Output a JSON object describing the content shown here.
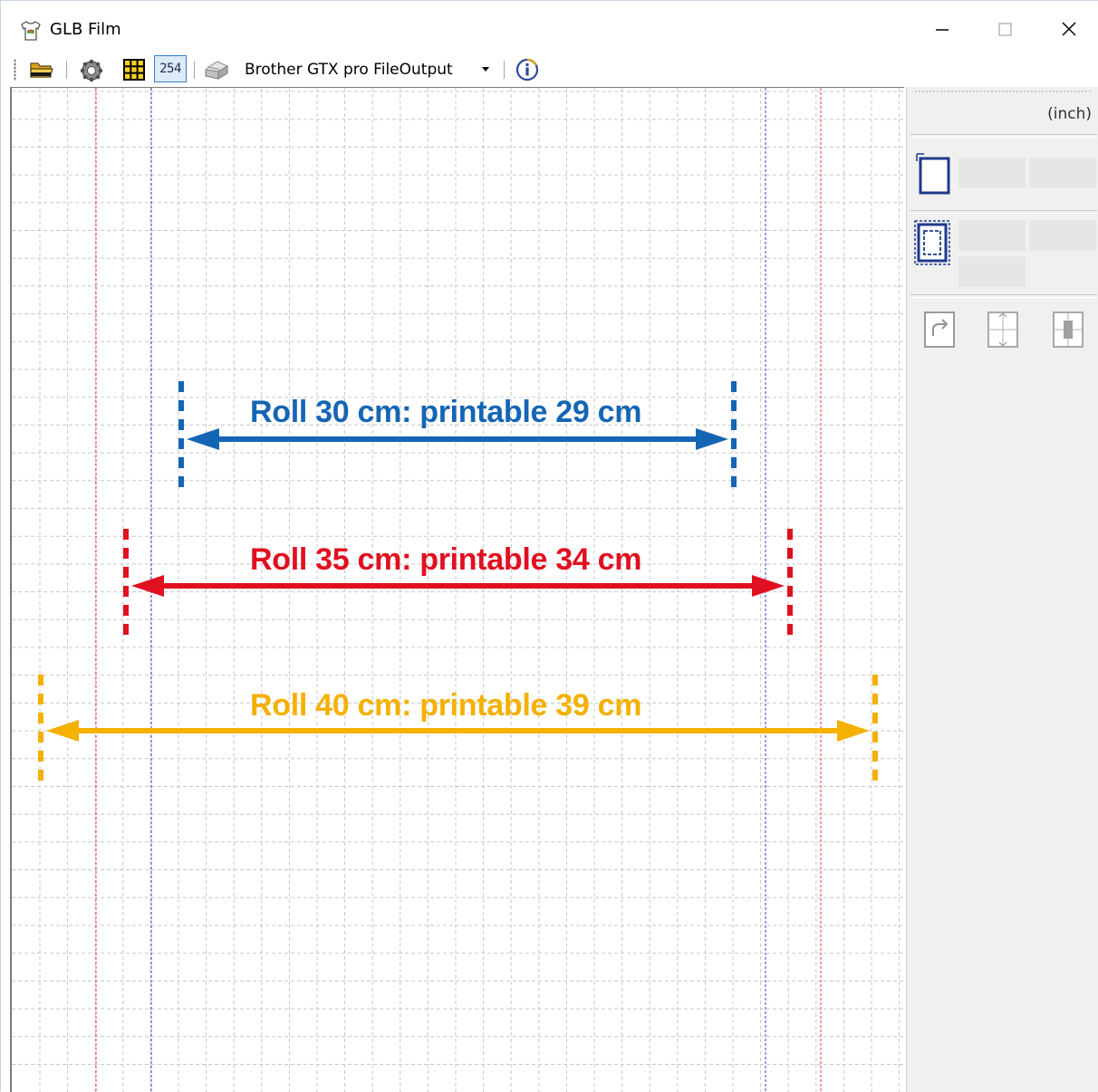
{
  "window": {
    "title": "GLB Film",
    "controls": {
      "minimize": "minimize-icon",
      "maximize": "maximize-icon",
      "close": "close-icon"
    }
  },
  "toolbar": {
    "buttons": [
      {
        "name": "open-folder",
        "icon": "folder-icon"
      },
      {
        "name": "settings",
        "icon": "gear-icon"
      },
      {
        "name": "grid",
        "icon": "grid-icon"
      },
      {
        "name": "resolution",
        "icon": "number-icon"
      },
      {
        "name": "printer",
        "icon": "printer-icon"
      },
      {
        "name": "info",
        "icon": "info-icon"
      }
    ],
    "resolution_label": "254",
    "printer_select": {
      "selected": "Brother GTX pro FileOutput"
    }
  },
  "canvas": {
    "colors": {
      "background": "#ffffff",
      "grid": "#c8c8c8",
      "blue_guide": "#3a3ae8",
      "red_guide": "#e83a3a"
    },
    "annotations": [
      {
        "label": "Roll 30 cm: printable 29 cm",
        "color": "#1565b5"
      },
      {
        "label": "Roll 35 cm: printable 34 cm",
        "color": "#e01020"
      },
      {
        "label": "Roll 40 cm: printable 39 cm",
        "color": "#f5b000"
      }
    ]
  },
  "side_panel": {
    "unit": "(inch)",
    "icons": [
      "page-size-icon",
      "printable-area-icon",
      "rotate-icon",
      "fit-width-icon",
      "center-icon"
    ]
  }
}
